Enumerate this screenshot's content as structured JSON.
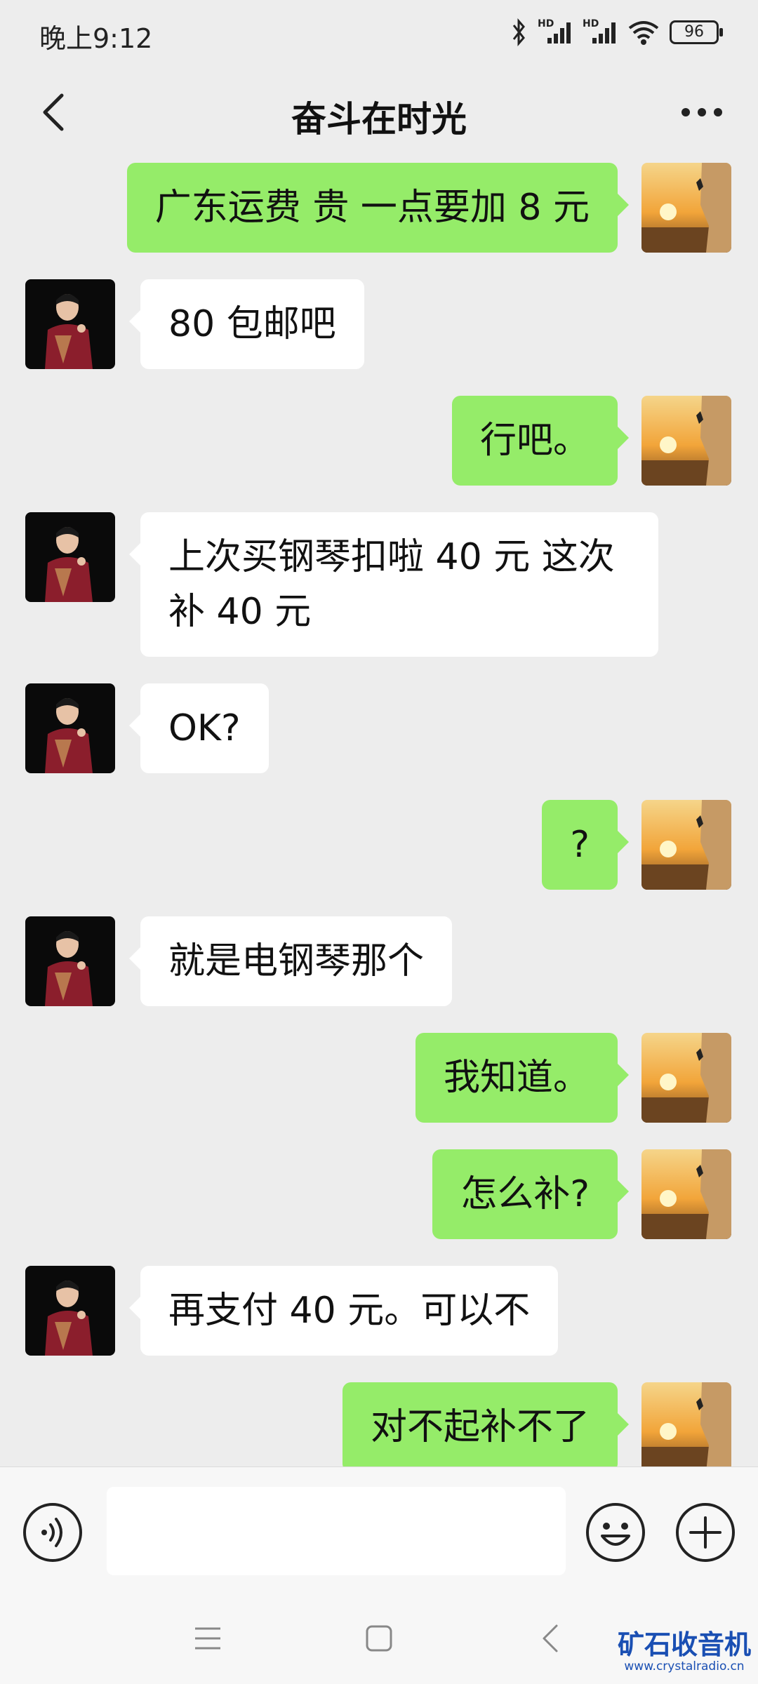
{
  "status_bar": {
    "time": "晚上9:12",
    "hd1": "HD",
    "hd2": "HD",
    "battery": "96"
  },
  "header": {
    "title": "奋斗在时光",
    "back_icon": "chevron-left-icon",
    "more_icon": "more-dots-icon"
  },
  "messages": [
    {
      "side": "right",
      "text": "广东运费 贵 一点要加 8 元"
    },
    {
      "side": "left",
      "text": "80 包邮吧"
    },
    {
      "side": "right",
      "text": "行吧。"
    },
    {
      "side": "left",
      "text": "上次买钢琴扣啦 40 元 这次\n补 40 元"
    },
    {
      "side": "left",
      "text": "OK?"
    },
    {
      "side": "right",
      "text": "?"
    },
    {
      "side": "left",
      "text": "就是电钢琴那个"
    },
    {
      "side": "right",
      "text": "我知道。"
    },
    {
      "side": "right",
      "text": "怎么补?"
    },
    {
      "side": "left",
      "text": "再支付 40 元。可以不"
    },
    {
      "side": "right",
      "text": "对不起补不了"
    }
  ],
  "input_bar": {
    "placeholder": "",
    "voice_icon": "voice-icon",
    "emoji_icon": "emoji-icon",
    "plus_icon": "plus-icon"
  },
  "nav_bar": {
    "menu_icon": "menu-icon",
    "home_icon": "home-icon",
    "back_icon": "back-icon"
  },
  "watermark": {
    "title": "矿石收音机",
    "url": "www.crystalradio.cn"
  },
  "colors": {
    "background": "#ededed",
    "bubble_self": "#95ec69",
    "bubble_other": "#ffffff",
    "watermark": "#1a4fb3"
  }
}
